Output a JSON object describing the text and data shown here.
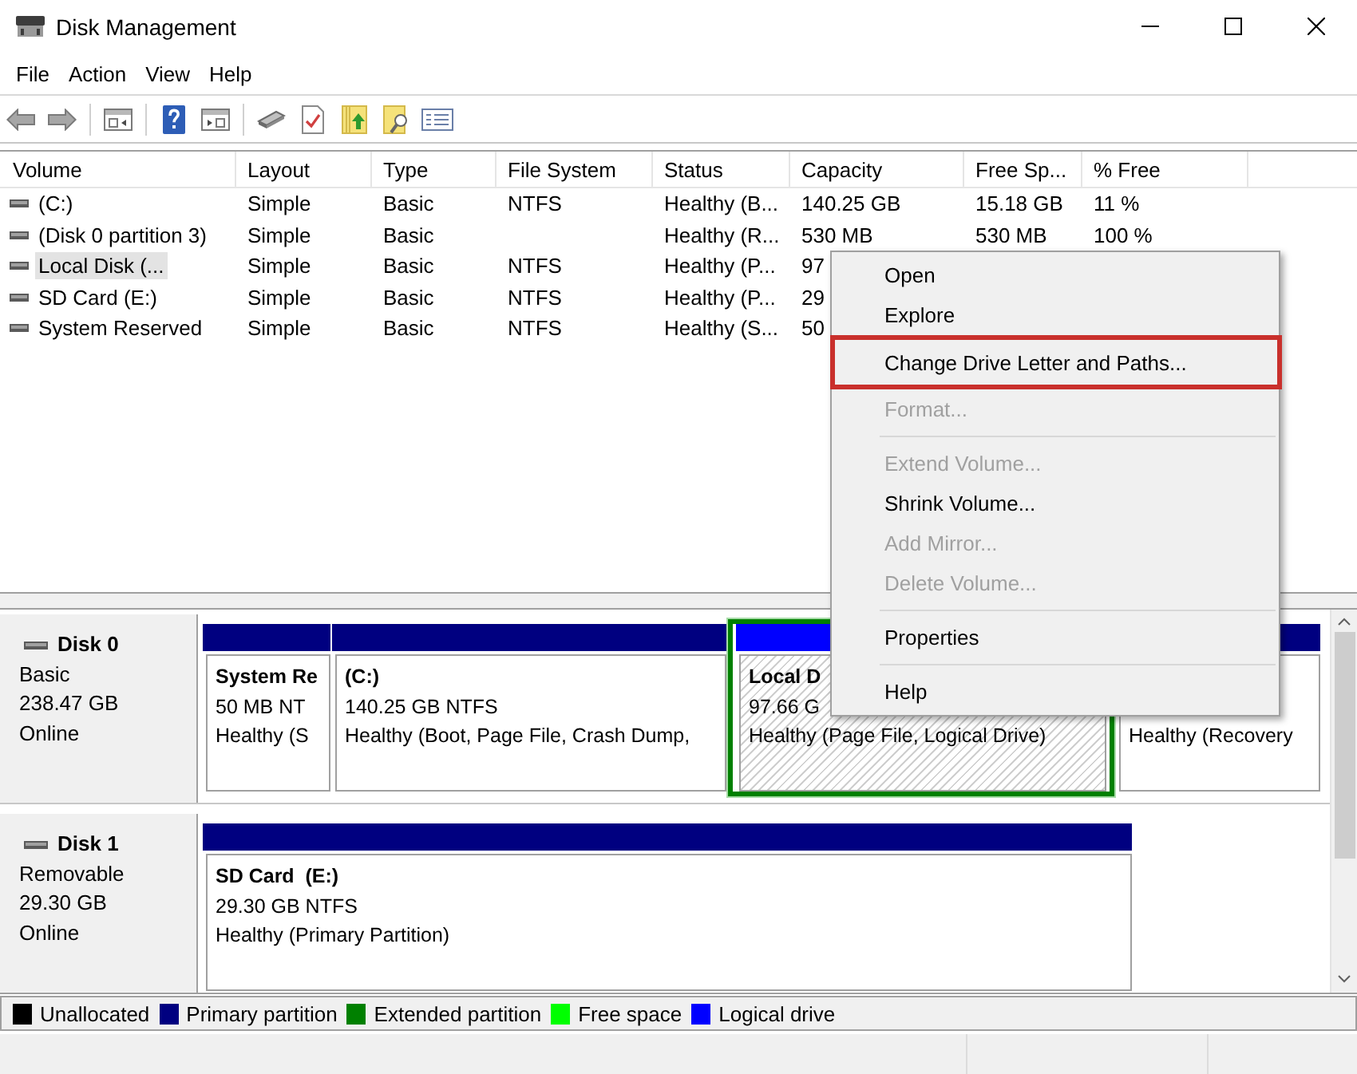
{
  "window": {
    "title": "Disk Management"
  },
  "menu_bar": [
    "File",
    "Action",
    "View",
    "Help"
  ],
  "volume_table": {
    "columns": [
      "Volume",
      "Layout",
      "Type",
      "File System",
      "Status",
      "Capacity",
      "Free Sp...",
      "% Free"
    ],
    "rows": [
      {
        "volume": "(C:)",
        "layout": "Simple",
        "type": "Basic",
        "file_system": "NTFS",
        "status": "Healthy (B...",
        "capacity": "140.25 GB",
        "free_space": "15.18 GB",
        "percent_free": "11 %",
        "selected": false
      },
      {
        "volume": "(Disk 0 partition 3)",
        "layout": "Simple",
        "type": "Basic",
        "status": "Healthy (R...",
        "capacity": "530 MB",
        "free_space": "530 MB",
        "percent_free": "100 %",
        "selected": false
      },
      {
        "volume": "Local Disk (...",
        "layout": "Simple",
        "type": "Basic",
        "file_system": "NTFS",
        "status": "Healthy (P...",
        "capacity": "97",
        "selected": true
      },
      {
        "volume": "SD Card (E:)",
        "layout": "Simple",
        "type": "Basic",
        "file_system": "NTFS",
        "status": "Healthy (P...",
        "capacity": "29",
        "selected": false
      },
      {
        "volume": "System Reserved",
        "layout": "Simple",
        "type": "Basic",
        "file_system": "NTFS",
        "status": "Healthy (S...",
        "capacity": "50",
        "selected": false
      }
    ]
  },
  "disks": [
    {
      "name": "Disk 0",
      "type": "Basic",
      "size": "238.47 GB",
      "state": "Online",
      "partitions": [
        {
          "kind": "volume",
          "color": "#000080",
          "name": "System Re",
          "size": "50 MB NT",
          "status": "Healthy (S",
          "selected": false
        },
        {
          "kind": "volume",
          "color": "#000080",
          "name": "(C:)",
          "size": "140.25 GB NTFS",
          "status": "Healthy (Boot, Page File, Crash Dump,",
          "selected": false
        },
        {
          "kind": "extended",
          "color": "#008000",
          "volumes": [
            {
              "color": "#0000ff",
              "name": "Local D",
              "size": "97.66 G",
              "status": "Healthy (Page File, Logical Drive)",
              "selected": true
            }
          ]
        },
        {
          "kind": "volume",
          "color": "#000080",
          "status": "Healthy (Recovery",
          "selected": false
        }
      ]
    },
    {
      "name": "Disk 1",
      "type": "Removable",
      "size": "29.30 GB",
      "state": "Online",
      "partitions": [
        {
          "kind": "volume",
          "color": "#000080",
          "name": "SD Card  (E:)",
          "size": "29.30 GB NTFS",
          "status": "Healthy (Primary Partition)",
          "selected": false
        }
      ]
    }
  ],
  "legend": [
    {
      "label": "Unallocated",
      "color": "#000000"
    },
    {
      "label": "Primary partition",
      "color": "#000080"
    },
    {
      "label": "Extended partition",
      "color": "#008000"
    },
    {
      "label": "Free space",
      "color": "#00ff00"
    },
    {
      "label": "Logical drive",
      "color": "#0000ff"
    }
  ],
  "context_menu": [
    {
      "kind": "item",
      "label": "Open",
      "disabled": false,
      "highlighted": false
    },
    {
      "kind": "item",
      "label": "Explore",
      "disabled": false,
      "highlighted": false
    },
    {
      "kind": "item",
      "label": "Change Drive Letter and Paths...",
      "disabled": false,
      "highlighted": true
    },
    {
      "kind": "item",
      "label": "Format...",
      "disabled": true,
      "highlighted": false
    },
    {
      "kind": "separator"
    },
    {
      "kind": "item",
      "label": "Extend Volume...",
      "disabled": true,
      "highlighted": false
    },
    {
      "kind": "item",
      "label": "Shrink Volume...",
      "disabled": false,
      "highlighted": false
    },
    {
      "kind": "item",
      "label": "Add Mirror...",
      "disabled": true,
      "highlighted": false
    },
    {
      "kind": "item",
      "label": "Delete Volume...",
      "disabled": true,
      "highlighted": false
    },
    {
      "kind": "separator"
    },
    {
      "kind": "item",
      "label": "Properties",
      "disabled": false,
      "highlighted": false
    },
    {
      "kind": "separator"
    },
    {
      "kind": "item",
      "label": "Help",
      "disabled": false,
      "highlighted": false
    }
  ]
}
